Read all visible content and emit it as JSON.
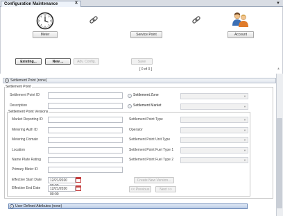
{
  "tabs": [
    {
      "label": "Configuration Maintenance",
      "close": "X"
    }
  ],
  "tab_menu_glyph": "▼",
  "toolbar": {
    "meter_label": "Meter",
    "service_point_label": "Service Point",
    "account_label": "Account",
    "existing_label": "Existing...",
    "new_label": "New ...",
    "adv_config_label": "Adv. Config.",
    "save_label": "Save"
  },
  "pager": {
    "indicator": "[ 0 of 0 ]"
  },
  "section": {
    "title": "Settlement Point (none)"
  },
  "settlement_point": {
    "group_title": "Settlement Point",
    "id_label": "Settlement Point ID",
    "description_label": "Description",
    "zone_label": "Settlement Zone",
    "market_label": "Settlement Market"
  },
  "versions": {
    "group_title": "Settlement Point Versions",
    "left_labels": {
      "market_reporting_id": "Market Reporting ID",
      "metering_auth_id": "Metering Auth ID",
      "metering_domain": "Metering Domain",
      "location": "Location",
      "name_plate_rating": "Name Plate Rating",
      "primary_meter_id": "Primary Meter ID",
      "effective_start_date": "Effective Start Date",
      "effective_end_date": "Effective End Date"
    },
    "right_labels": {
      "type": "Settlement Point Type",
      "operator": "Operator",
      "unit_type": "Settlement Point Unit Type",
      "fuel_type_1": "Settlement Point Fuel Type 1",
      "fuel_type_2": "Settlement Point Fuel Type 2"
    },
    "effective_start_value": "12/21/2020 00:00",
    "effective_end_value": "12/21/2020 00:00",
    "create_new_version_label": "Create New Version...",
    "previous_label": "<< Previous",
    "next_label": "Next >>"
  },
  "uda": {
    "title": "User Defined Attributes (none)"
  },
  "colors": {
    "accent_blue": "#b9cbe6",
    "tab_bg": "#eef3fa"
  },
  "icons": [
    "meter-clock-icon",
    "chain-link-icon",
    "chain-link-icon",
    "account-people-icon",
    "calendar-icon"
  ]
}
